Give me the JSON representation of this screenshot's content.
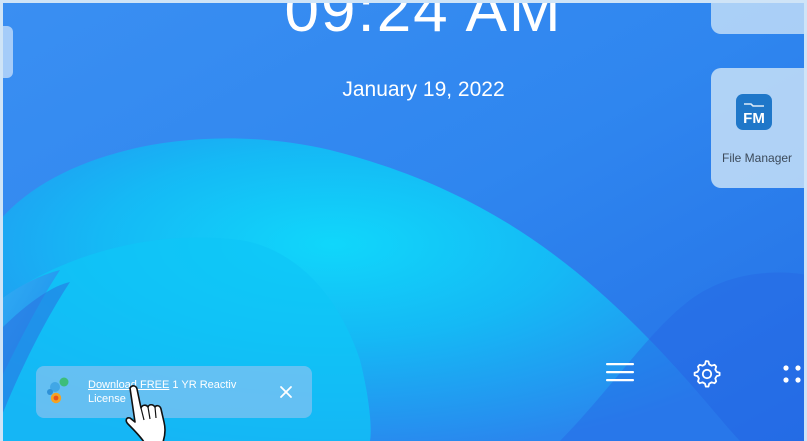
{
  "clock": {
    "time": "09:24 AM",
    "date": "January 19, 2022"
  },
  "dock": {
    "apps": [
      {
        "label": "File Manager",
        "icon": "file-manager-icon",
        "icon_text": "FM"
      }
    ]
  },
  "bottom_bar": {
    "icons": [
      "menu-icon",
      "settings-gear-icon",
      "apps-grid-icon"
    ]
  },
  "notification": {
    "link_text": "Download FREE",
    "rest_text": " 1 YR Reactiv",
    "second_line": "License",
    "app_icon": "app-logo-icon",
    "close_icon": "close-icon"
  },
  "colors": {
    "wallpaper_light": "#13d0f8",
    "wallpaper_dark": "#1f6fe6",
    "card_bg": "#cde4f8",
    "fm_icon_bg": "#1f77c9"
  }
}
